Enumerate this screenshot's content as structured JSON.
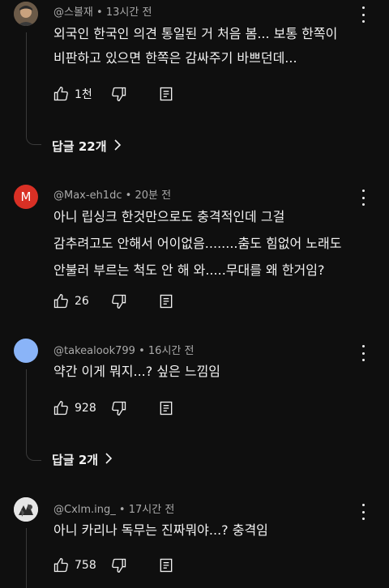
{
  "comments": [
    {
      "handle": "@스볼재",
      "time": "13시간 전",
      "text": "외국인 한국인 의견 통일된 거 처음 봄... 보통 한쪽이\n비판하고 있으면 한쪽은 감싸주기 바쁘던데...",
      "likes": "1천",
      "replies": "답글 22개"
    },
    {
      "handle": "@Max-eh1dc",
      "time": "20분 전",
      "avatar_letter": "M",
      "avatar_color": "#d93025",
      "text": "아니 립싱크 한것만으로도 충격적인데 그걸\n감추려고도 안해서 어이없음........춤도 힘없어 노래도\n안불러 부르는 척도 안 해 와.....무대를 왜 한거임?",
      "likes": "26"
    },
    {
      "handle": "@takealook799",
      "time": "16시간 전",
      "avatar_color": "#8ab4f8",
      "text": "약간 이게 뭐지...? 싶은 느낌임",
      "likes": "928",
      "replies": "답글 2개"
    },
    {
      "handle": "@Cxlm.ing_",
      "time": "17시간 전",
      "text": "아니 카리나 독무는 진짜뭐야...? 충격임",
      "likes": "758"
    }
  ]
}
